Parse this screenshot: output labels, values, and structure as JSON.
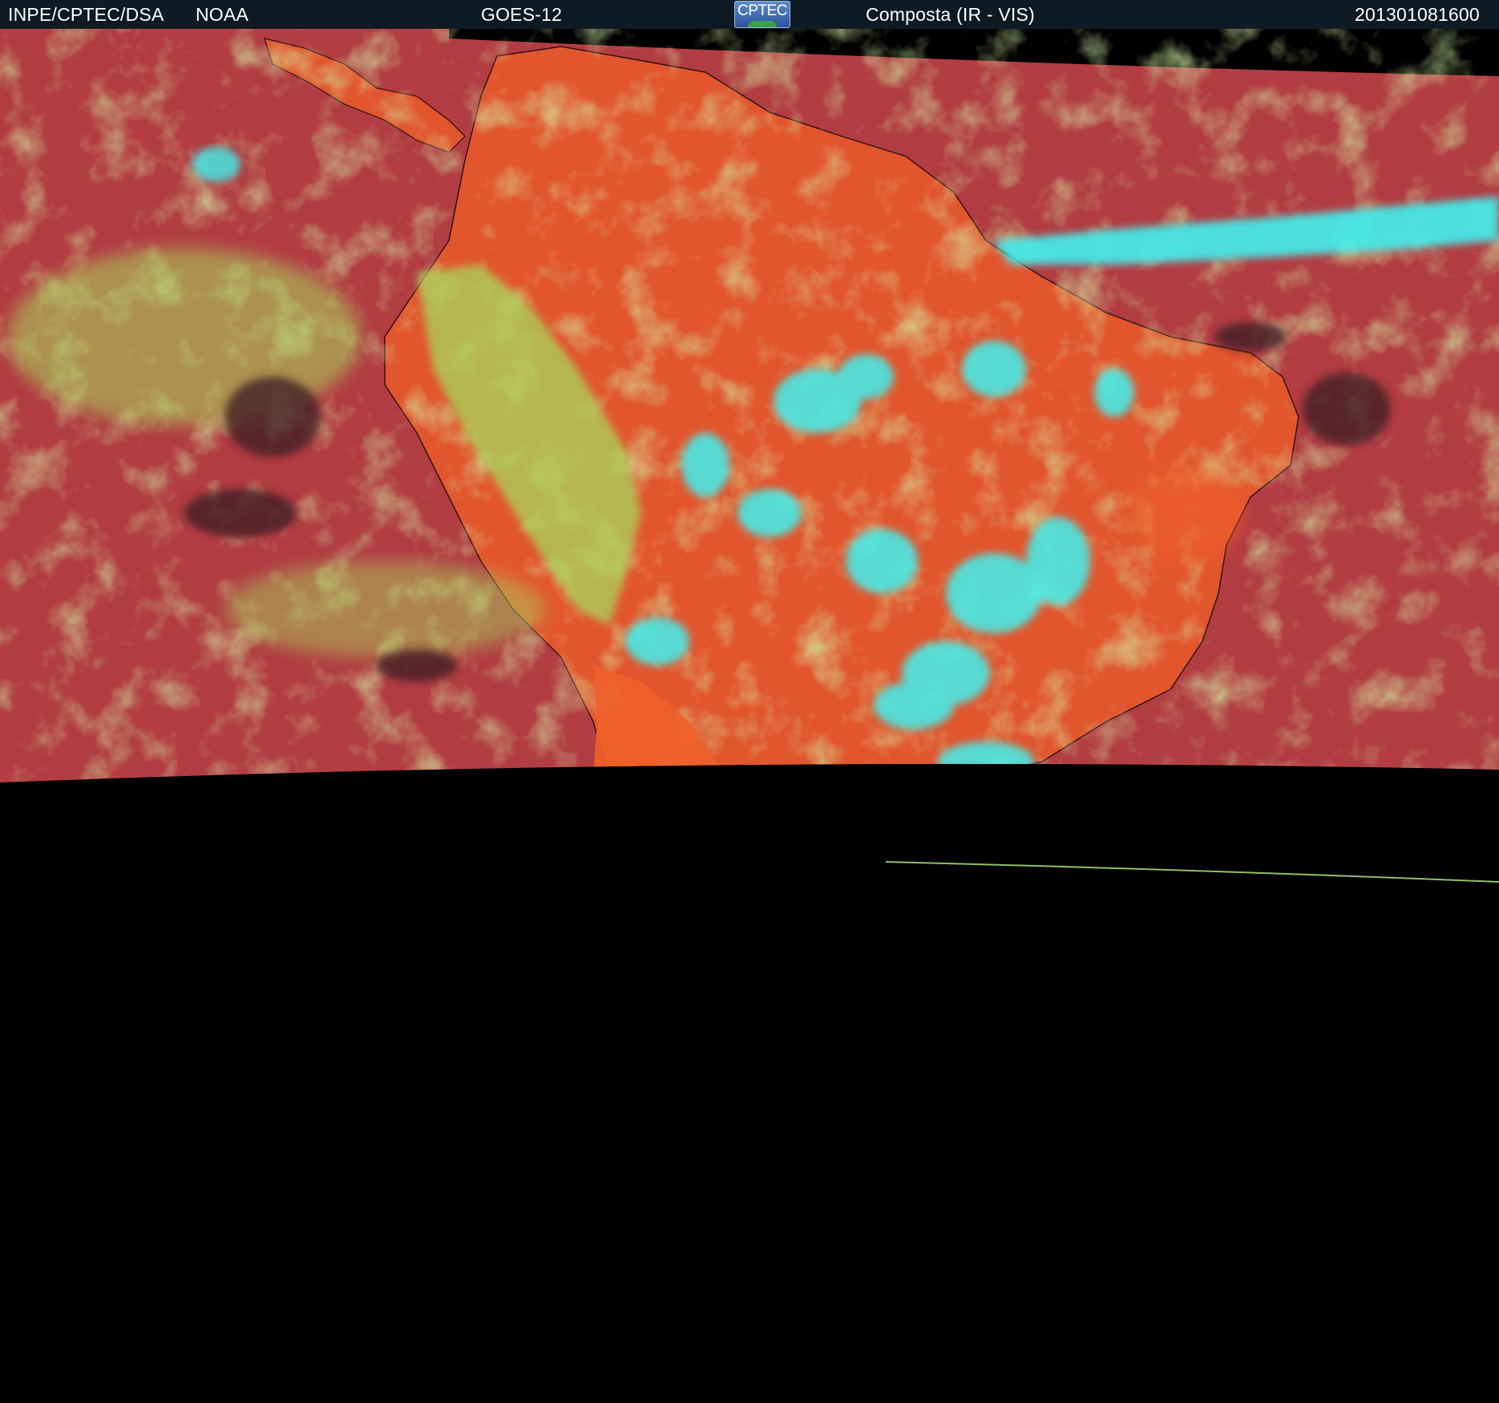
{
  "header": {
    "source": "INPE/CPTEC/DSA",
    "agency": "NOAA",
    "satellite": "GOES-12",
    "logo_text": "CPTEC",
    "product": "Composta (IR - VIS)",
    "timestamp": "201301081600"
  },
  "colors": {
    "header_bg": "#0f1b24",
    "ocean": "#b23d43",
    "land": "#e2562e",
    "low_cloud": "#a8d65c",
    "high_cloud": "#3ff0ee",
    "clear_dark": "#3a1d24",
    "no_data": "#000000"
  }
}
